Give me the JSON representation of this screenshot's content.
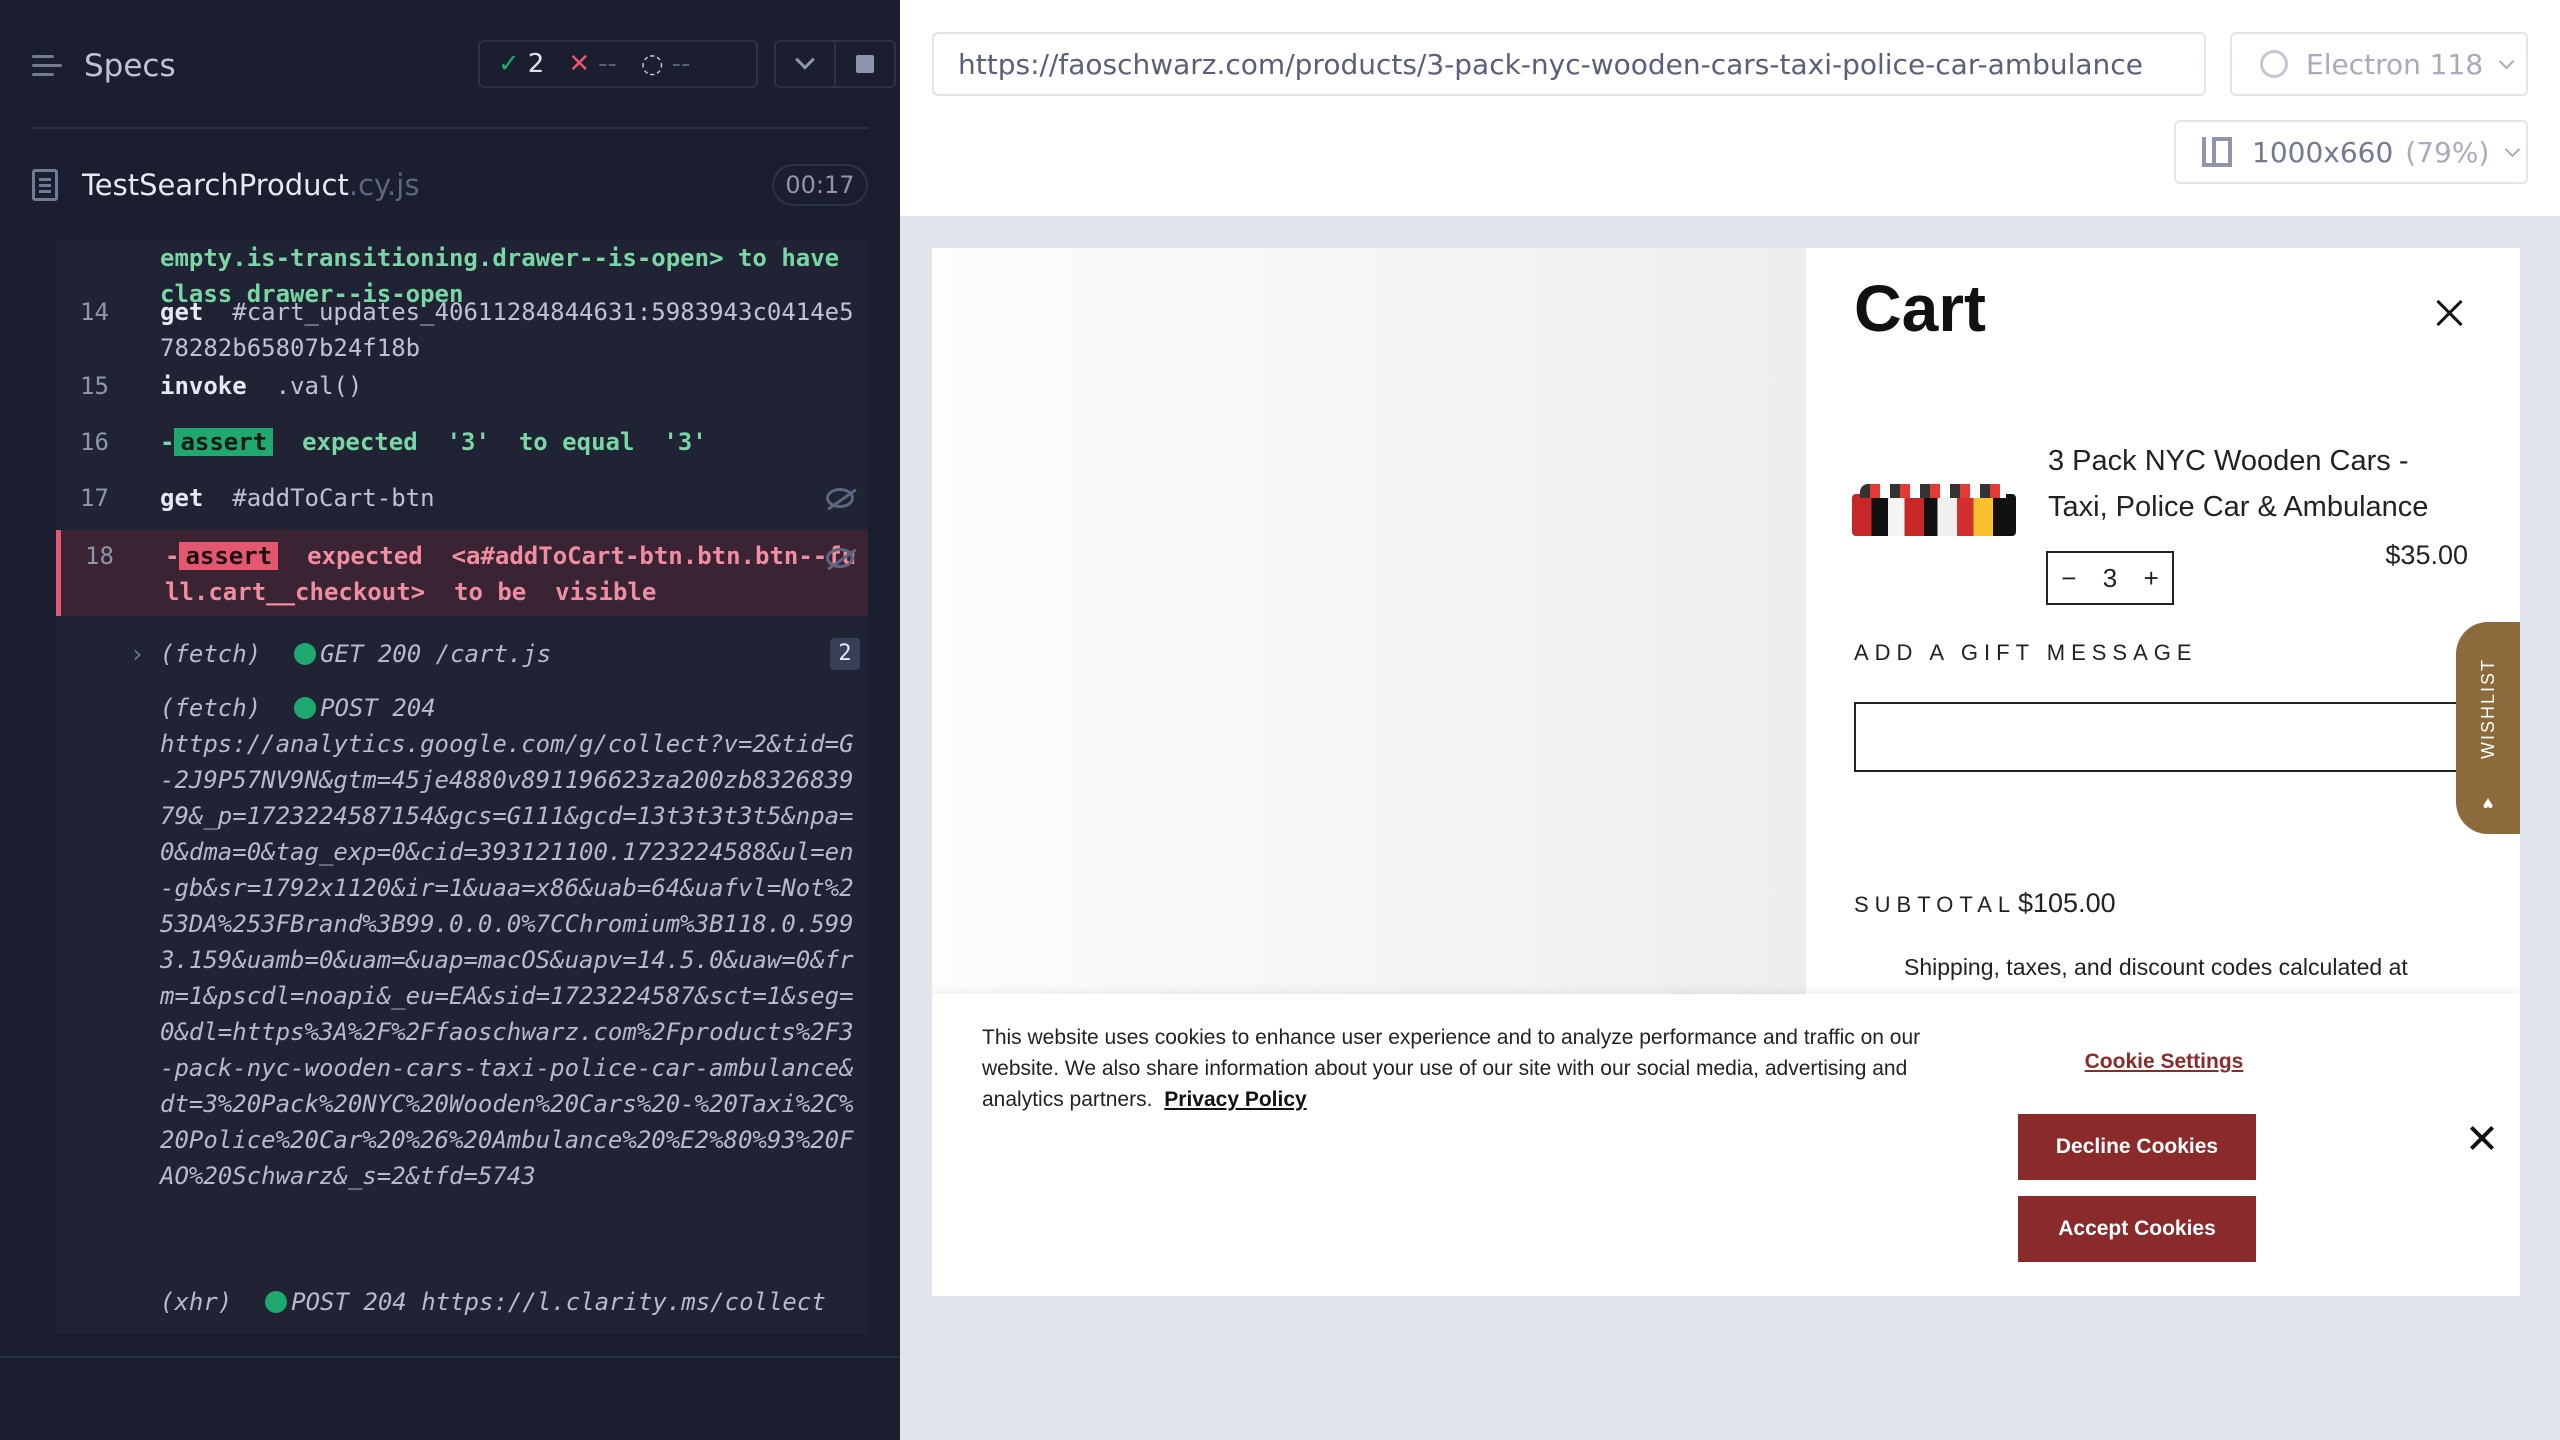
{
  "runner": {
    "specs_title": "Specs",
    "stats": {
      "passed": "2",
      "failed": "--",
      "pending": "--"
    },
    "spec_file": {
      "name": "TestSearchProduct",
      "ext": ".cy.js",
      "duration": "00:17"
    },
    "log": {
      "top_line1_sel": "empty.is-transitioning.drawer--is-open>",
      "top_line1_rest": " to have",
      "top_line2_a": "class",
      "top_line2_b": " drawer--is-open",
      "c14_num": "14",
      "c14_kw": "get",
      "c14_arg": "#cart_updates_40611284844631:5983943c0414e578282b65807b24f18b",
      "c15_num": "15",
      "c15_kw": "invoke",
      "c15_arg": ".val()",
      "c16_num": "16",
      "c16_dash": "-",
      "c16_badge": "assert",
      "c16_a": "expected",
      "c16_b": "'3'",
      "c16_c": "to equal",
      "c16_d": "'3'",
      "c17_num": "17",
      "c17_kw": "get",
      "c17_arg": "#addToCart-btn",
      "c18_num": "18",
      "c18_dash": "-",
      "c18_badge": "assert",
      "c18_a": "expected",
      "c18_b": "<a#addToCart-btn.btn.btn--full.cart__checkout>",
      "c18_c": "to be",
      "c18_d": "visible",
      "f1_type": "(fetch)",
      "f1_text": "GET 200 /cart.js",
      "f1_count": "2",
      "f2_type": "(fetch)",
      "f2_text": "POST 204",
      "f2_url": "https://analytics.google.com/g/collect?v=2&tid=G-2J9P57NV9N&gtm=45je4880v891196623za200zb832683979&_p=1723224587154&gcs=G111&gcd=13t3t3t3t5&npa=0&dma=0&tag_exp=0&cid=393121100.1723224588&ul=en-gb&sr=1792x1120&ir=1&uaa=x86&uab=64&uafvl=Not%253DA%253FBrand%3B99.0.0.0%7CChromium%3B118.0.5993.159&uamb=0&uam=&uap=macOS&uapv=14.5.0&uaw=0&frm=1&pscdl=noapi&_eu=EA&sid=1723224587&sct=1&seg=0&dl=https%3A%2F%2Ffaoschwarz.com%2Fproducts%2F3-pack-nyc-wooden-cars-taxi-police-car-ambulance&dt=3%20Pack%20NYC%20Wooden%20Cars%20-%20Taxi%2C%20Police%20Car%20%26%20Ambulance%20%E2%80%93%20FAO%20Schwarz&_s=2&tfd=5743",
      "x1_type": "(xhr)",
      "x1_text": "POST 204 https://l.clarity.ms/collect"
    }
  },
  "aut": {
    "url": "https://faoschwarz.com/products/3-pack-nyc-wooden-cars-taxi-police-car-ambulance",
    "browser": "Electron 118",
    "viewport": "1000x660",
    "viewport_pct": "(79%)"
  },
  "page": {
    "cart_title": "Cart",
    "product_name": "3 Pack NYC Wooden Cars - Taxi, Police Car & Ambulance",
    "qty_minus": "−",
    "qty_value": "3",
    "qty_plus": "+",
    "price": "$35.00",
    "gift_label": "ADD A GIFT MESSAGE",
    "subtotal_label": "SUBTOTAL",
    "subtotal_value": "$105.00",
    "shipping_note": "Shipping, taxes, and discount codes calculated at",
    "wishlist": "WISHLIST",
    "cookie": {
      "text": "This website uses cookies to enhance user experience and to analyze performance and traffic on our website. We also share information about your use of our site with our social media, advertising and analytics partners.",
      "privacy_link": "Privacy Policy",
      "settings": "Cookie Settings",
      "decline": "Decline Cookies",
      "accept": "Accept Cookies"
    }
  },
  "colors": {
    "runner_bg": "#1b1e2e",
    "pass": "#1fa971",
    "fail": "#e45770",
    "brand_red": "#8b2a2a",
    "wishlist_gold": "#8c6a3c"
  }
}
